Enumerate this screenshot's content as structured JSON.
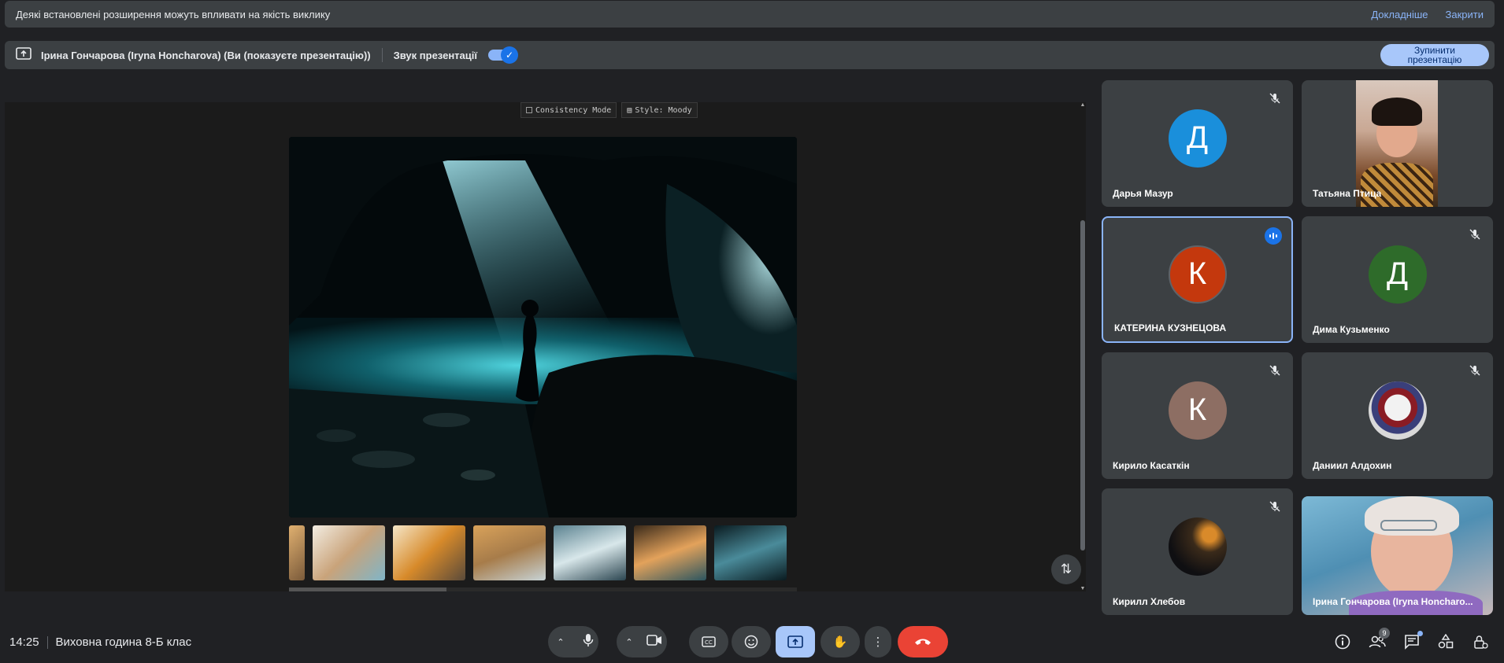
{
  "banner": {
    "message": "Деякі встановлені розширення можуть впливати на якість виклику",
    "learn_more": "Докладніше",
    "close": "Закрити"
  },
  "presenting": {
    "label": "Ірина Гончарова (Iryna Honcharova) (Ви (показуєте презентацію))",
    "audio_label": "Звук презентації",
    "audio_on": true,
    "stop_button": "Зупинити презентацію"
  },
  "slide": {
    "consistency_mode": "Consistency Mode",
    "style": "Style: Moody",
    "thumbnails": 7
  },
  "participants": [
    {
      "name": "Дарья Мазур",
      "initial": "Д",
      "color": "#1a8fdb",
      "muted": true
    },
    {
      "name": "Татьяна Птица",
      "video": true,
      "muted": false
    },
    {
      "name": "КАТЕРИНА КУЗНЕЦОВА",
      "initial": "К",
      "color": "#c4380d",
      "speaking": true
    },
    {
      "name": "Дима Кузьменко",
      "initial": "Д",
      "color": "#2e6b2a",
      "muted": true
    },
    {
      "name": "Кирило Касаткін",
      "initial": "К",
      "color": "#8d6e63",
      "muted": true
    },
    {
      "name": "Даниил Алдохин",
      "avatar_image": true,
      "muted": true
    },
    {
      "name": "Кирилл Хлебов",
      "avatar_image": true,
      "muted": true
    },
    {
      "name": "Ірина Гончарова (Iryna Honcharo...",
      "video": true
    }
  ],
  "footer": {
    "time": "14:25",
    "meeting_title": "Виховна година 8-Б клас",
    "people_count": "9"
  },
  "icons": {
    "mic": "mic-icon",
    "camera": "camera-icon",
    "captions": "captions-icon",
    "emoji": "emoji-icon",
    "present": "present-icon",
    "hand": "raise-hand-icon",
    "more": "more-vert-icon",
    "end": "end-call-icon",
    "info": "info-icon",
    "people": "people-icon",
    "chat": "chat-icon",
    "activities": "activities-icon",
    "host": "host-controls-icon"
  }
}
